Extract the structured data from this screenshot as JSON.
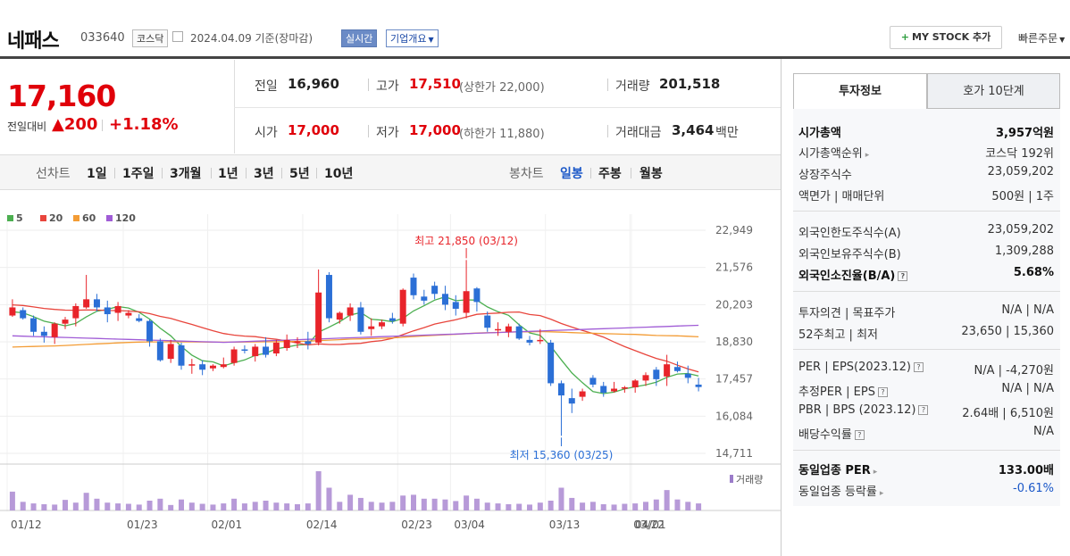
{
  "header": {
    "stock_name": "네패스",
    "code": "033640",
    "market": "코스닥",
    "date_text": "2024.04.09  기준(장마감)",
    "realtime": "실시간",
    "overview": "기업개요",
    "mystock_label": "MY STOCK 추가",
    "quick_order": "빠른주문"
  },
  "price": {
    "current": "17,160",
    "change_label": "전일대비",
    "change": "200",
    "change_pct": "+1.18%"
  },
  "quote": {
    "prev_label": "전일",
    "prev": "16,960",
    "high_label": "고가",
    "high": "17,510",
    "upper_limit": "(상한가 22,000)",
    "volume_label": "거래량",
    "volume": "201,518",
    "open_label": "시가",
    "open": "17,000",
    "low_label": "저가",
    "low": "17,000",
    "lower_limit": "(하한가 11,880)",
    "amount_label": "거래대금",
    "amount": "3,464",
    "amount_unit": "백만"
  },
  "period": {
    "line_label": "선차트",
    "line_items": [
      "1일",
      "1주일",
      "3개월",
      "1년",
      "3년",
      "5년",
      "10년"
    ],
    "candle_label": "봉차트",
    "candle_items": [
      "일봉",
      "주봉",
      "월봉"
    ],
    "candle_selected": "일봉"
  },
  "right": {
    "tab_invest": "투자정보",
    "tab_ask": "호가 10단계",
    "rows": {
      "mcap_label": "시가총액",
      "mcap": "3,957억원",
      "mcap_rank_label": "시가총액순위",
      "mcap_rank": "코스닥 192위",
      "shares_label": "상장주식수",
      "shares": "23,059,202",
      "par_label": "액면가 | 매매단위",
      "par": "500원 | 1주",
      "foreign_limit_label": "외국인한도주식수(A)",
      "foreign_limit": "23,059,202",
      "foreign_hold_label": "외국인보유주식수(B)",
      "foreign_hold": "1,309,288",
      "foreign_ratio_label": "외국인소진율(B/A)",
      "foreign_ratio": "5.68%",
      "opinion_label": "투자의견 | 목표주가",
      "opinion": "N/A | N/A",
      "w52_label": "52주최고 | 최저",
      "w52": "23,650 | 15,360",
      "per_label": "PER | EPS(2023.12)",
      "per": "N/A | -4,270원",
      "est_per_label": "추정PER | EPS",
      "est_per": "N/A | N/A",
      "pbr_label": "PBR | BPS (2023.12)",
      "pbr": "2.64배 | 6,510원",
      "div_label": "배당수익률",
      "div": "N/A",
      "ind_per_label": "동일업종 PER",
      "ind_per": "133.00배",
      "ind_rate_label": "동일업종 등락률",
      "ind_rate": "-0.61%"
    }
  },
  "chart_data": {
    "type": "candlestick",
    "legend": [
      {
        "name": "5",
        "color": "#4caf50"
      },
      {
        "name": "20",
        "color": "#e8453c"
      },
      {
        "name": "60",
        "color": "#f39c35"
      },
      {
        "name": "120",
        "color": "#a05cd6"
      }
    ],
    "y_ticks": [
      "22,949",
      "21,576",
      "20,203",
      "18,830",
      "17,457",
      "16,084",
      "14,711"
    ],
    "ylim": [
      14711,
      22949
    ],
    "x_ticks": [
      "01/12",
      "01/23",
      "02/01",
      "02/14",
      "02/23",
      "03/04",
      "03/13",
      "03/22",
      "04/01"
    ],
    "high_annotation": "최고 21,850 (03/12)",
    "low_annotation": "최저 15,360 (03/25)",
    "volume_label": "거래량",
    "candles": [
      [
        19800,
        20400,
        19750,
        20100
      ],
      [
        20000,
        20100,
        19650,
        19700
      ],
      [
        19700,
        19800,
        19050,
        19200
      ],
      [
        19200,
        19400,
        18800,
        19050
      ],
      [
        19000,
        19550,
        18750,
        19500
      ],
      [
        19500,
        19750,
        19300,
        19650
      ],
      [
        19700,
        20250,
        19400,
        20150
      ],
      [
        20100,
        21300,
        20050,
        20400
      ],
      [
        20400,
        20600,
        19950,
        20100
      ],
      [
        20100,
        20350,
        19550,
        19850
      ],
      [
        19900,
        20300,
        19600,
        20150
      ],
      [
        19800,
        20000,
        19700,
        19900
      ],
      [
        19700,
        19850,
        19550,
        19600
      ],
      [
        19600,
        19650,
        18650,
        18850
      ],
      [
        18850,
        18950,
        18100,
        18150
      ],
      [
        18200,
        18900,
        18050,
        18750
      ],
      [
        18700,
        18800,
        17800,
        17950
      ],
      [
        17950,
        18200,
        17650,
        18000
      ],
      [
        18000,
        18150,
        17600,
        17800
      ],
      [
        17850,
        18000,
        17750,
        17950
      ],
      [
        17900,
        18250,
        17850,
        18000
      ],
      [
        18050,
        18650,
        17950,
        18550
      ],
      [
        18550,
        18700,
        18400,
        18500
      ],
      [
        18300,
        18750,
        18100,
        18650
      ],
      [
        18650,
        19000,
        18250,
        18350
      ],
      [
        18400,
        18900,
        18300,
        18800
      ],
      [
        18600,
        19100,
        18500,
        18900
      ],
      [
        18800,
        19000,
        18600,
        18850
      ],
      [
        18850,
        19200,
        18550,
        18750
      ],
      [
        18800,
        21500,
        18700,
        20650
      ],
      [
        21300,
        21400,
        19550,
        19700
      ],
      [
        19650,
        19950,
        19500,
        19900
      ],
      [
        19800,
        20250,
        19600,
        20100
      ],
      [
        20100,
        20300,
        19100,
        19200
      ],
      [
        19300,
        19700,
        19050,
        19400
      ],
      [
        19400,
        19650,
        19300,
        19550
      ],
      [
        19700,
        19900,
        19500,
        19600
      ],
      [
        19500,
        20800,
        19400,
        20750
      ],
      [
        21200,
        21350,
        20400,
        20550
      ],
      [
        20500,
        20750,
        20200,
        20350
      ],
      [
        20900,
        21050,
        20400,
        20600
      ],
      [
        20600,
        20900,
        20000,
        20200
      ],
      [
        20300,
        20550,
        19800,
        20050
      ],
      [
        19900,
        21850,
        19700,
        20700
      ],
      [
        20800,
        20850,
        19950,
        20300
      ],
      [
        19800,
        19950,
        19200,
        19350
      ],
      [
        19300,
        19550,
        19050,
        19300
      ],
      [
        19200,
        19500,
        19000,
        19400
      ],
      [
        19400,
        19500,
        18900,
        18950
      ],
      [
        18900,
        19050,
        18700,
        18800
      ],
      [
        18900,
        19300,
        18750,
        18900
      ],
      [
        18800,
        18900,
        17200,
        17300
      ],
      [
        17300,
        17400,
        15360,
        16850
      ],
      [
        16750,
        17100,
        16200,
        16550
      ],
      [
        16800,
        17100,
        16650,
        17000
      ],
      [
        17500,
        17600,
        17150,
        17250
      ],
      [
        17200,
        17350,
        16800,
        16950
      ],
      [
        17000,
        17350,
        16950,
        17100
      ],
      [
        17100,
        17200,
        16950,
        17150
      ],
      [
        17150,
        17450,
        16950,
        17400
      ],
      [
        17400,
        17700,
        17200,
        17600
      ],
      [
        17800,
        17900,
        17200,
        17450
      ],
      [
        17550,
        18350,
        17200,
        18000
      ],
      [
        17900,
        18100,
        17700,
        17750
      ],
      [
        17650,
        17950,
        17300,
        17500
      ],
      [
        17250,
        17500,
        17000,
        17160
      ]
    ],
    "volumes": [
      48,
      22,
      18,
      16,
      15,
      27,
      20,
      45,
      30,
      20,
      18,
      17,
      15,
      25,
      30,
      14,
      28,
      20,
      17,
      15,
      18,
      30,
      18,
      22,
      25,
      20,
      18,
      16,
      18,
      100,
      58,
      22,
      40,
      32,
      22,
      20,
      22,
      38,
      40,
      30,
      30,
      28,
      24,
      38,
      30,
      20,
      18,
      16,
      17,
      15,
      20,
      25,
      58,
      32,
      20,
      22,
      16,
      15,
      17,
      18,
      22,
      28,
      52,
      28,
      22,
      18
    ]
  }
}
